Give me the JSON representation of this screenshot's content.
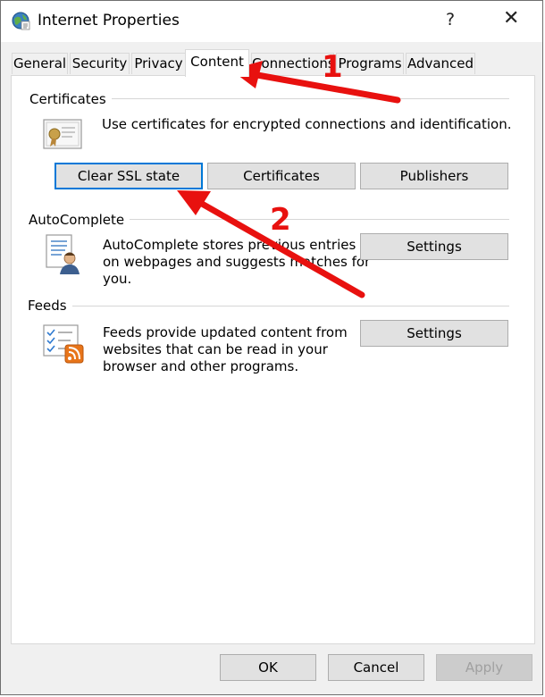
{
  "window": {
    "title": "Internet Properties",
    "help_glyph": "?",
    "close_glyph": "✕"
  },
  "tabs": [
    {
      "label": "General"
    },
    {
      "label": "Security"
    },
    {
      "label": "Privacy"
    },
    {
      "label": "Content",
      "active": true
    },
    {
      "label": "Connections"
    },
    {
      "label": "Programs"
    },
    {
      "label": "Advanced"
    }
  ],
  "certificates": {
    "title": "Certificates",
    "description": "Use certificates for encrypted connections and identification.",
    "clear_ssl_label": "Clear SSL state",
    "certificates_label": "Certificates",
    "publishers_label": "Publishers"
  },
  "autocomplete": {
    "title": "AutoComplete",
    "description_lines": [
      "AutoComplete stores previous entries",
      "on webpages and suggests matches for",
      "you."
    ],
    "settings_label": "Settings"
  },
  "feeds": {
    "title": "Feeds",
    "description_lines": [
      "Feeds provide updated content from",
      "websites that can be read in your",
      "browser and other programs."
    ],
    "settings_label": "Settings"
  },
  "footer": {
    "ok_label": "OK",
    "cancel_label": "Cancel",
    "apply_label": "Apply"
  },
  "annotations": {
    "step1": "1",
    "step2": "2",
    "arrow_color": "#e8110f"
  },
  "colors": {
    "focus_border": "#0078d7"
  }
}
